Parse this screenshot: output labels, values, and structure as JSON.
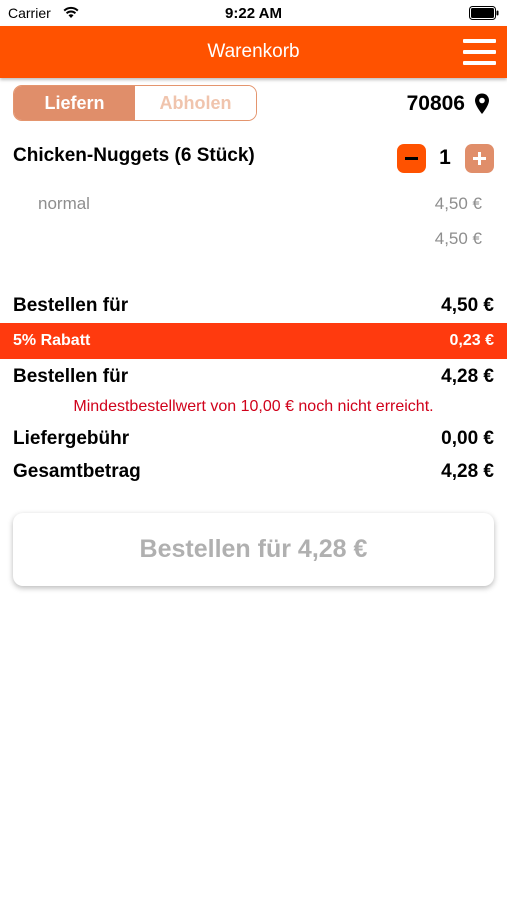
{
  "status_bar": {
    "carrier": "Carrier",
    "time": "9:22 AM"
  },
  "nav": {
    "title": "Warenkorb",
    "menu_icon": "hamburger-menu-icon",
    "color": "#ff5200"
  },
  "delivery_toggle": {
    "options": [
      "Liefern",
      "Abholen"
    ],
    "selected": "Liefern"
  },
  "location": {
    "zip": "70806",
    "icon": "location-pin-icon"
  },
  "cart": {
    "item": {
      "name": "Chicken-Nuggets (6 Stück)",
      "quantity": "1",
      "variant": "normal",
      "variant_price": "4,50 €",
      "total": "4,50 €"
    }
  },
  "summary": {
    "subtotal_label": "Bestellen für",
    "subtotal_value": "4,50 €",
    "discount_label": "5% Rabatt",
    "discount_value": "0,23 €",
    "discounted_label": "Bestellen für",
    "discounted_value": "4,28 €",
    "warning": "Mindestbestellwert von 10,00 € noch nicht erreicht.",
    "delivery_fee_label": "Liefergebühr",
    "delivery_fee_value": "0,00 €",
    "total_label": "Gesamtbetrag",
    "total_value": "4,28 €"
  },
  "order_button": {
    "label": "Bestellen für 4,28 €",
    "enabled": false
  }
}
